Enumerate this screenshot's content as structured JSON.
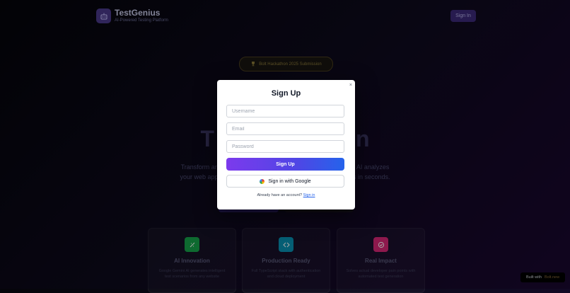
{
  "header": {
    "brand_name": "TestGenius",
    "brand_sub": "AI-Powered Testing Platform",
    "signin_label": "Sign In",
    "logo_icon": "robot-icon"
  },
  "hero": {
    "badge": "Bolt Hackathon 2025 Submission",
    "badge_icon": "trophy-icon",
    "title_left": "T",
    "title_right": "n",
    "desc_line1": "Transform any we",
    "desc_line1_right": "s. Our AI analyzes",
    "desc_line2": "your web applic",
    "desc_line2_right": "ests in seconds."
  },
  "cards": [
    {
      "title": "AI Innovation",
      "desc": "Google Gemini AI generates intelligent test scenarios from any website",
      "icon": "sparkle-icon",
      "color": "#16a34a"
    },
    {
      "title": "Production Ready",
      "desc": "Full TypeScript stack with authentication and cloud deployment",
      "icon": "code-icon",
      "color": "#0891b2"
    },
    {
      "title": "Real Impact",
      "desc": "Solves actual developer pain points with automated test generation",
      "icon": "check-circle-icon",
      "color": "#db2777"
    }
  ],
  "modal": {
    "title": "Sign Up",
    "close": "×",
    "username_placeholder": "Username",
    "email_placeholder": "Email",
    "password_placeholder": "Password",
    "submit_label": "Sign Up",
    "google_label": "Sign in with Google",
    "switch_text": "Already have an account?",
    "switch_link": "Sign in"
  },
  "footer": {
    "built_with": "Built with",
    "built_brand": "Bolt.new"
  }
}
